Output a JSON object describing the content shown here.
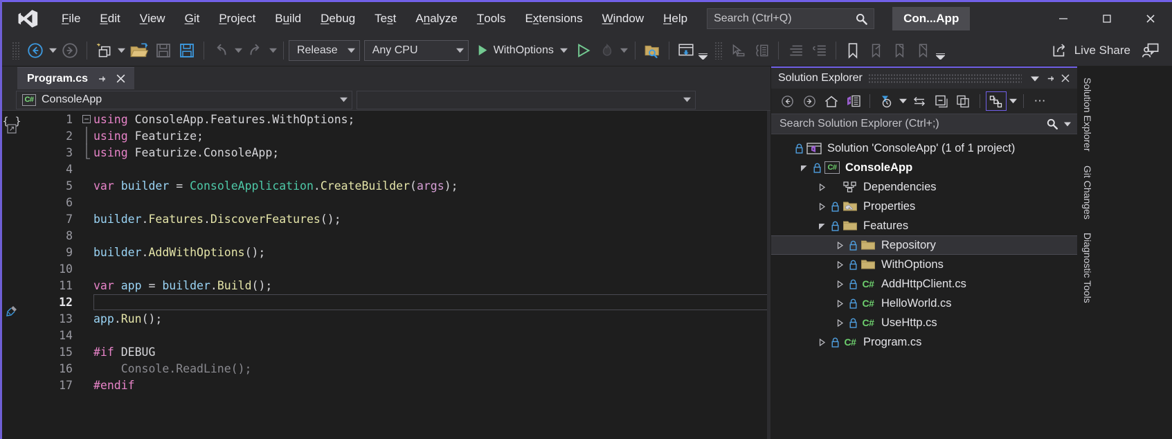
{
  "window": {
    "title": "Con...App",
    "logo_icon": "visual-studio-logo",
    "minimize_label": "—",
    "maximize_label": "☐",
    "close_label": "✕"
  },
  "menu": {
    "items": [
      {
        "pre": "",
        "key": "F",
        "post": "ile"
      },
      {
        "pre": "",
        "key": "E",
        "post": "dit"
      },
      {
        "pre": "",
        "key": "V",
        "post": "iew"
      },
      {
        "pre": "",
        "key": "G",
        "post": "it"
      },
      {
        "pre": "",
        "key": "P",
        "post": "roject"
      },
      {
        "pre": "B",
        "key": "u",
        "post": "ild"
      },
      {
        "pre": "",
        "key": "D",
        "post": "ebug"
      },
      {
        "pre": "Te",
        "key": "s",
        "post": "t"
      },
      {
        "pre": "A",
        "key": "n",
        "post": "alyze"
      },
      {
        "pre": "",
        "key": "T",
        "post": "ools"
      },
      {
        "pre": "E",
        "key": "x",
        "post": "tensions"
      },
      {
        "pre": "",
        "key": "W",
        "post": "indow"
      },
      {
        "pre": "",
        "key": "H",
        "post": "elp"
      }
    ]
  },
  "search": {
    "placeholder": "Search (Ctrl+Q)",
    "value": "",
    "icon": "search-icon"
  },
  "toolbar": {
    "back_icon": "navigate-back-icon",
    "forward_icon": "navigate-forward-icon",
    "new_project_icon": "new-project-icon",
    "open_icon": "open-file-icon",
    "save_icon": "save-icon",
    "save_all_icon": "save-all-icon",
    "undo_icon": "undo-icon",
    "redo_icon": "redo-icon",
    "configuration": "Release",
    "platform": "Any CPU",
    "run_target": "WithOptions",
    "run_icon": "play-icon",
    "start_without_debug_icon": "play-outline-icon",
    "hot_reload_icon": "hot-reload-icon",
    "find_in_files_icon": "find-in-files-icon",
    "window_layout_icon": "window-layout-icon",
    "pointer_icon": "select-element-icon",
    "indent_icon": "indent-icon",
    "outdent_icon": "outdent-icon",
    "comment_icon": "comment-icon",
    "uncomment_icon": "uncomment-icon",
    "bookmark_icon": "bookmark-icon",
    "prev_bookmark_icon": "previous-bookmark-icon",
    "next_bookmark_icon": "next-bookmark-icon",
    "clear_bookmark_icon": "clear-bookmarks-icon",
    "overflow_icon": "toolbar-overflow-icon",
    "live_share_label": "Live Share",
    "live_share_icon": "live-share-icon",
    "account_icon": "account-manager-icon"
  },
  "editor": {
    "tab": {
      "title": "Program.cs",
      "pin_icon": "pin-icon",
      "close_icon": "close-icon"
    },
    "navbar": {
      "project": "ConsoleApp",
      "project_icon": "csharp-project-icon",
      "member": "",
      "caret_icon": "chevron-down-icon"
    },
    "current_line": 12,
    "quick_actions_icon": "quick-actions-screwdriver-icon",
    "structure_icon": "code-block-icon",
    "lines": [
      {
        "n": 1,
        "fold": "minus",
        "tokens": [
          {
            "t": "using ",
            "c": "k"
          },
          {
            "t": "ConsoleApp.Features.WithOptions;",
            "c": "pun"
          }
        ]
      },
      {
        "n": 2,
        "fold": "bar",
        "tokens": [
          {
            "t": "using ",
            "c": "k"
          },
          {
            "t": "Featurize;",
            "c": "pun"
          }
        ]
      },
      {
        "n": 3,
        "fold": "barend",
        "tokens": [
          {
            "t": "using ",
            "c": "k"
          },
          {
            "t": "Featurize.ConsoleApp;",
            "c": "pun"
          }
        ]
      },
      {
        "n": 4,
        "fold": "",
        "tokens": []
      },
      {
        "n": 5,
        "fold": "",
        "tokens": [
          {
            "t": "var ",
            "c": "k"
          },
          {
            "t": "builder ",
            "c": "id"
          },
          {
            "t": "= ",
            "c": "pun"
          },
          {
            "t": "ConsoleApplication",
            "c": "typ"
          },
          {
            "t": ".",
            "c": "pun"
          },
          {
            "t": "CreateBuilder",
            "c": "mth"
          },
          {
            "t": "(",
            "c": "pun"
          },
          {
            "t": "args",
            "c": "par"
          },
          {
            "t": ");",
            "c": "pun"
          }
        ]
      },
      {
        "n": 6,
        "fold": "",
        "tokens": []
      },
      {
        "n": 7,
        "fold": "",
        "tokens": [
          {
            "t": "builder",
            "c": "id"
          },
          {
            "t": ".",
            "c": "pun"
          },
          {
            "t": "Features",
            "c": "mth"
          },
          {
            "t": ".",
            "c": "pun"
          },
          {
            "t": "DiscoverFeatures",
            "c": "mth"
          },
          {
            "t": "();",
            "c": "pun"
          }
        ]
      },
      {
        "n": 8,
        "fold": "",
        "tokens": []
      },
      {
        "n": 9,
        "fold": "",
        "tokens": [
          {
            "t": "builder",
            "c": "id"
          },
          {
            "t": ".",
            "c": "pun"
          },
          {
            "t": "AddWithOptions",
            "c": "mth"
          },
          {
            "t": "();",
            "c": "pun"
          }
        ]
      },
      {
        "n": 10,
        "fold": "",
        "tokens": []
      },
      {
        "n": 11,
        "fold": "",
        "tokens": [
          {
            "t": "var ",
            "c": "k"
          },
          {
            "t": "app ",
            "c": "id"
          },
          {
            "t": "= ",
            "c": "pun"
          },
          {
            "t": "builder",
            "c": "id"
          },
          {
            "t": ".",
            "c": "pun"
          },
          {
            "t": "Build",
            "c": "mth"
          },
          {
            "t": "();",
            "c": "pun"
          }
        ]
      },
      {
        "n": 12,
        "fold": "",
        "current": true,
        "tokens": []
      },
      {
        "n": 13,
        "fold": "",
        "tokens": [
          {
            "t": "app",
            "c": "id"
          },
          {
            "t": ".",
            "c": "pun"
          },
          {
            "t": "Run",
            "c": "mth"
          },
          {
            "t": "();",
            "c": "pun"
          }
        ]
      },
      {
        "n": 14,
        "fold": "",
        "tokens": []
      },
      {
        "n": 15,
        "fold": "",
        "tokens": [
          {
            "t": "#if",
            "c": "k"
          },
          {
            "t": " DEBUG",
            "c": "pp"
          }
        ]
      },
      {
        "n": 16,
        "fold": "",
        "tokens": [
          {
            "t": "    Console.ReadLine();",
            "c": "dis"
          }
        ]
      },
      {
        "n": 17,
        "fold": "",
        "tokens": [
          {
            "t": "#endif",
            "c": "k"
          }
        ]
      }
    ]
  },
  "solution_explorer": {
    "title": "Solution Explorer",
    "header_buttons": {
      "caret_icon": "chevron-down-icon",
      "pin_icon": "pin-icon",
      "close_icon": "close-icon"
    },
    "toolbar": {
      "back_icon": "back-icon",
      "forward_icon": "forward-icon",
      "home_icon": "home-icon",
      "solution_view_icon": "solution-view-icon",
      "pending_changes_icon": "pending-changes-filter-icon",
      "sync_icon": "sync-with-active-document-icon",
      "collapse_all_icon": "collapse-all-icon",
      "properties_icon": "show-all-files-icon",
      "class_view_icon": "class-view-icon",
      "overflow_icon": "overflow-icon"
    },
    "search": {
      "placeholder": "Search Solution Explorer (Ctrl+;)",
      "value": "",
      "icon": "search-icon",
      "caret_icon": "chevron-down-icon"
    },
    "tree": [
      {
        "indent": 0,
        "twisty": "none",
        "lock": true,
        "icon": "solution",
        "label": "Solution 'ConsoleApp' (1 of 1 project)",
        "bold": false,
        "selected": false
      },
      {
        "indent": 1,
        "twisty": "expanded",
        "lock": true,
        "icon": "csproj",
        "label": "ConsoleApp",
        "bold": true,
        "selected": false
      },
      {
        "indent": 2,
        "twisty": "collapsed",
        "lock": false,
        "icon": "deps",
        "label": "Dependencies",
        "bold": false,
        "selected": false
      },
      {
        "indent": 2,
        "twisty": "collapsed",
        "lock": true,
        "icon": "folderwrench",
        "label": "Properties",
        "bold": false,
        "selected": false
      },
      {
        "indent": 2,
        "twisty": "expanded",
        "lock": true,
        "icon": "folder",
        "label": "Features",
        "bold": false,
        "selected": false
      },
      {
        "indent": 3,
        "twisty": "collapsed",
        "lock": true,
        "icon": "folder",
        "label": "Repository",
        "bold": false,
        "selected": true
      },
      {
        "indent": 3,
        "twisty": "collapsed",
        "lock": true,
        "icon": "folder",
        "label": "WithOptions",
        "bold": false,
        "selected": false
      },
      {
        "indent": 3,
        "twisty": "collapsed",
        "lock": true,
        "icon": "cs",
        "label": "AddHttpClient.cs",
        "bold": false,
        "selected": false
      },
      {
        "indent": 3,
        "twisty": "collapsed",
        "lock": true,
        "icon": "cs",
        "label": "HelloWorld.cs",
        "bold": false,
        "selected": false
      },
      {
        "indent": 3,
        "twisty": "collapsed",
        "lock": true,
        "icon": "cs",
        "label": "UseHttp.cs",
        "bold": false,
        "selected": false
      },
      {
        "indent": 2,
        "twisty": "collapsed",
        "lock": true,
        "icon": "cs",
        "label": "Program.cs",
        "bold": false,
        "selected": false
      }
    ]
  },
  "vertical_tabs": [
    {
      "label": "Solution Explorer"
    },
    {
      "label": "Git Changes"
    },
    {
      "label": "Diagnostic Tools"
    }
  ],
  "colors": {
    "accent_purple": "#7160e8",
    "run_green": "#73c991",
    "folder_gold": "#c9b26f",
    "keyword_pink": "#e884c9",
    "type_teal": "#4ec9a8",
    "method_yellow": "#e4e4a8",
    "identifier_blue": "#9ad4f5",
    "titlebar_bg": "#2d2d30",
    "editor_bg": "#1e1e1e"
  }
}
